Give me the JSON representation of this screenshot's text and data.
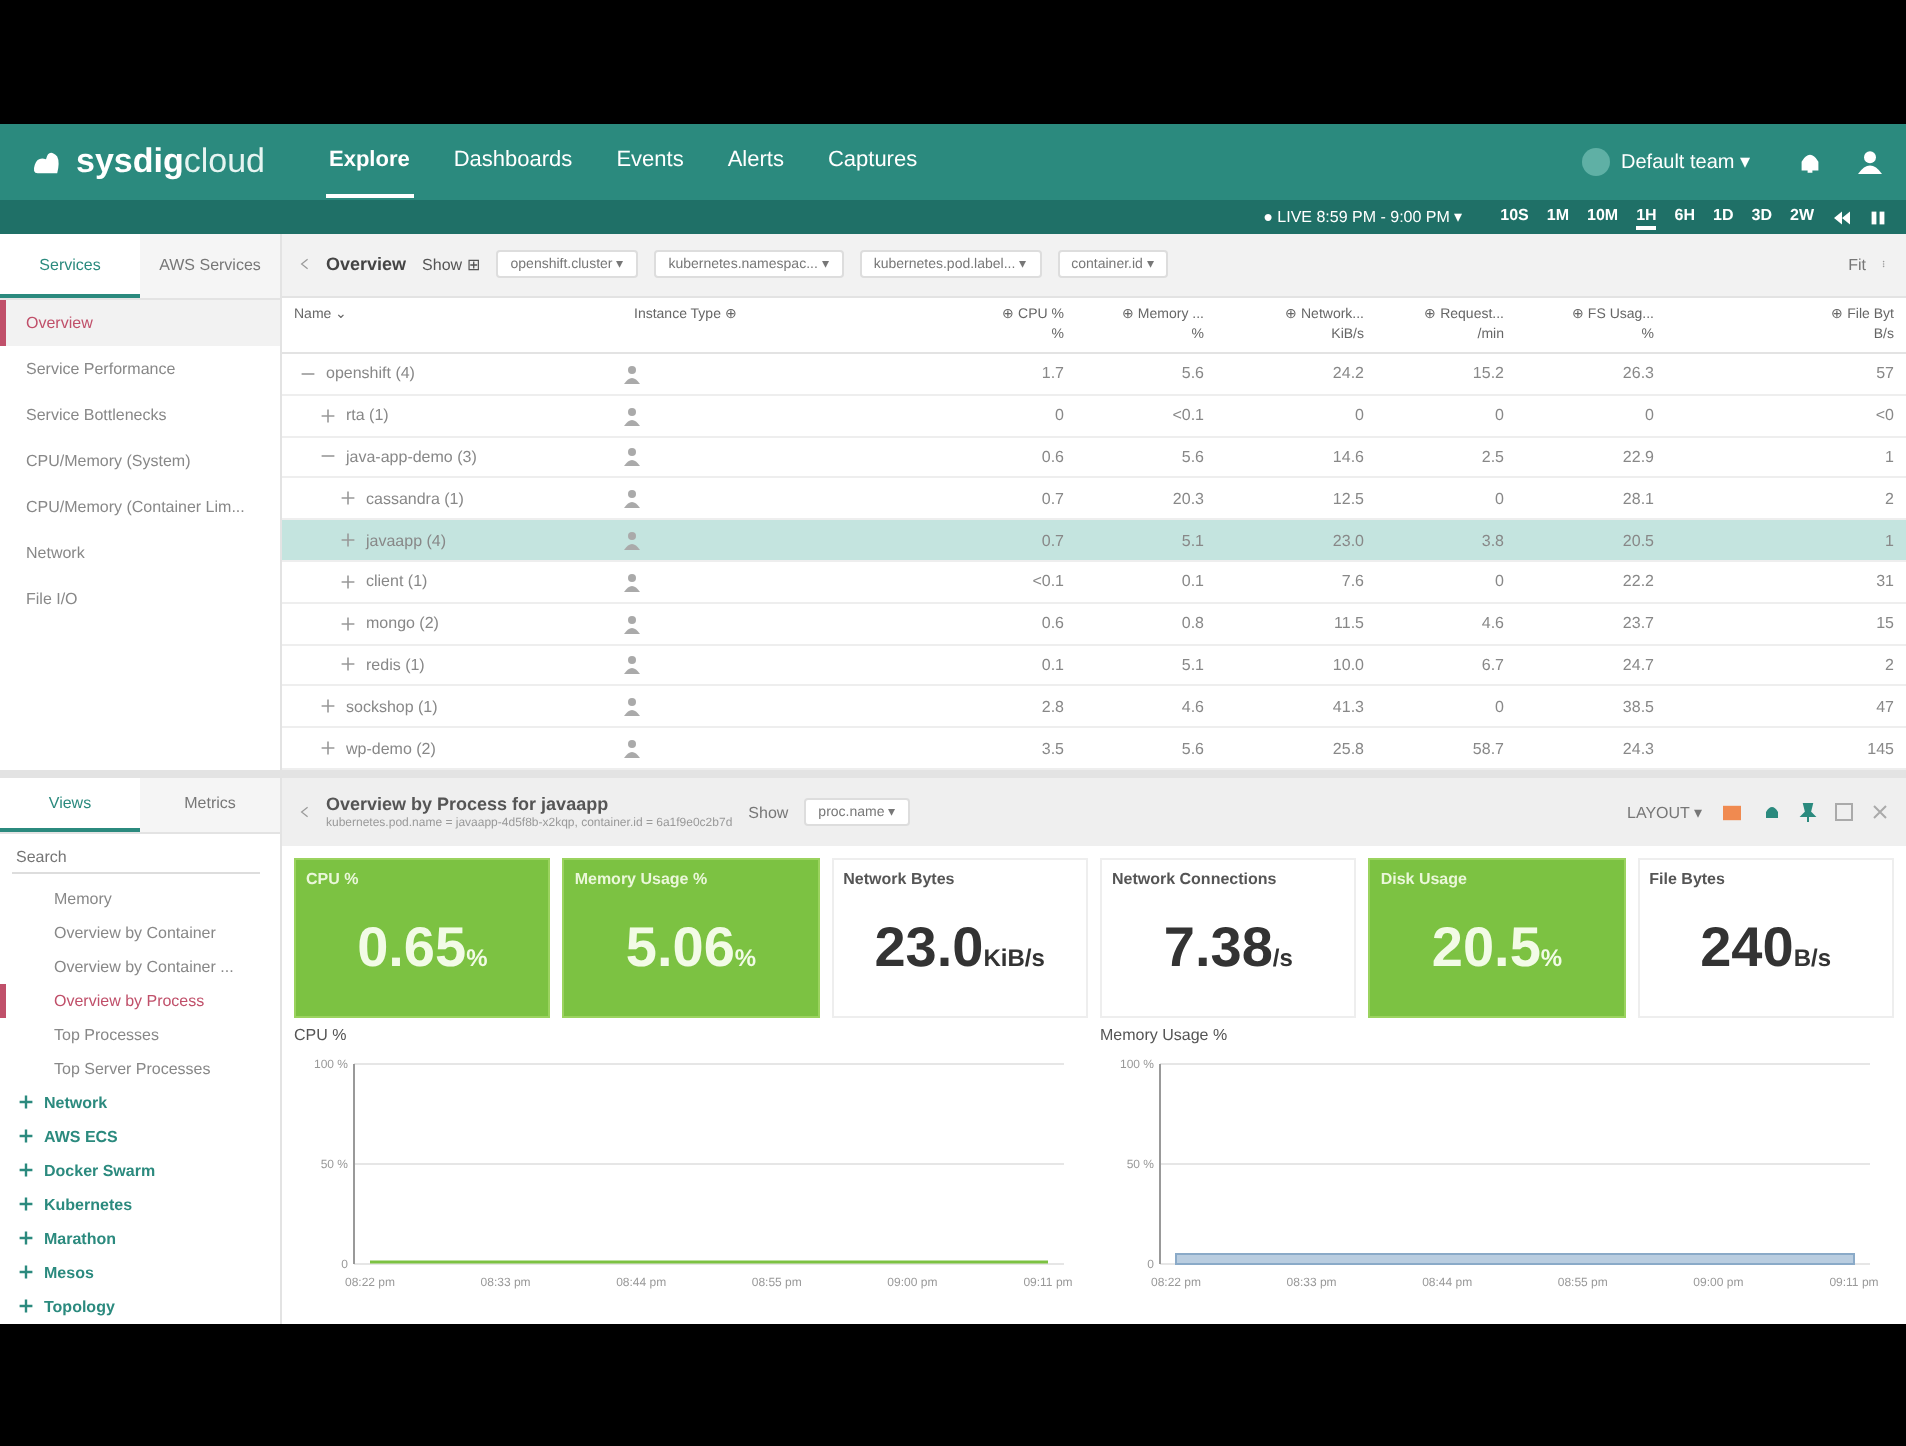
{
  "header": {
    "logo": "sysdig",
    "logo_suffix": "cloud",
    "nav": [
      {
        "label": "Explore",
        "selected": true
      },
      {
        "label": "Dashboards",
        "selected": false
      },
      {
        "label": "Events",
        "selected": false
      },
      {
        "label": "Alerts",
        "selected": false
      },
      {
        "label": "Captures",
        "selected": false
      }
    ],
    "team": "Default team ▾",
    "live": "● LIVE 8:59 PM - 9:00 PM ▾",
    "ranges": [
      {
        "label": "10S",
        "selected": false
      },
      {
        "label": "1M",
        "selected": false
      },
      {
        "label": "10M",
        "selected": false
      },
      {
        "label": "1H",
        "selected": true
      },
      {
        "label": "6H",
        "selected": false
      },
      {
        "label": "1D",
        "selected": false
      },
      {
        "label": "3D",
        "selected": false
      },
      {
        "label": "2W",
        "selected": false
      }
    ]
  },
  "sidebar": {
    "tabs": [
      {
        "label": "Services",
        "selected": true
      },
      {
        "label": "AWS Services",
        "selected": false
      }
    ],
    "items": [
      {
        "label": "Overview",
        "selected": true
      },
      {
        "label": "Service Performance",
        "selected": false
      },
      {
        "label": "Service Bottlenecks",
        "selected": false
      },
      {
        "label": "CPU/Memory (System)",
        "selected": false
      },
      {
        "label": "CPU/Memory (Container Lim...",
        "selected": false
      },
      {
        "label": "Network",
        "selected": false
      },
      {
        "label": "File I/O",
        "selected": false
      }
    ]
  },
  "breadcrumb": {
    "title": "Overview",
    "show": "Show ⊞",
    "filters": [
      "openshift.cluster ▾",
      "kubernetes.namespac... ▾",
      "kubernetes.pod.label... ▾",
      "container.id ▾"
    ],
    "fit": "Fit"
  },
  "table": {
    "columns": [
      {
        "label": "Name ⌄"
      },
      {
        "label": "Instance Type ⊕"
      },
      {
        "label": "⊕ CPU %",
        "unit": "%"
      },
      {
        "label": "⊕ Memory ...",
        "unit": "%"
      },
      {
        "label": "⊕ Network...",
        "unit": "KiB/s"
      },
      {
        "label": "⊕ Request...",
        "unit": "/min"
      },
      {
        "label": "⊕ FS Usag...",
        "unit": "%"
      },
      {
        "label": "⊕ File Byt",
        "unit": "B/s"
      }
    ],
    "rows": [
      {
        "name": "openshift (4)",
        "expanded": true,
        "selected": false,
        "values": [
          "1.7",
          "5.6",
          "24.2",
          "15.2",
          "26.3",
          "57"
        ],
        "children": [
          {
            "name": "rta (1)",
            "expanded": false,
            "selected": false,
            "values": [
              "0",
              "<0.1",
              "0",
              "0",
              "0",
              "<0"
            ]
          },
          {
            "name": "java-app-demo (3)",
            "expanded": true,
            "selected": false,
            "values": [
              "0.6",
              "5.6",
              "14.6",
              "2.5",
              "22.9",
              "1"
            ],
            "children": [
              {
                "name": "cassandra (1)",
                "expanded": false,
                "selected": false,
                "values": [
                  "0.7",
                  "20.3",
                  "12.5",
                  "0",
                  "28.1",
                  "2"
                ]
              },
              {
                "name": "javaapp (4)",
                "expanded": false,
                "selected": true,
                "values": [
                  "0.7",
                  "5.1",
                  "23.0",
                  "3.8",
                  "20.5",
                  "1"
                ]
              },
              {
                "name": "client (1)",
                "expanded": false,
                "selected": false,
                "values": [
                  "<0.1",
                  "0.1",
                  "7.6",
                  "0",
                  "22.2",
                  "31"
                ]
              },
              {
                "name": "mongo (2)",
                "expanded": false,
                "selected": false,
                "values": [
                  "0.6",
                  "0.8",
                  "11.5",
                  "4.6",
                  "23.7",
                  "15"
                ]
              },
              {
                "name": "redis (1)",
                "expanded": false,
                "selected": false,
                "values": [
                  "0.1",
                  "5.1",
                  "10.0",
                  "6.7",
                  "24.7",
                  "2"
                ]
              }
            ]
          },
          {
            "name": "sockshop (1)",
            "expanded": false,
            "selected": false,
            "values": [
              "2.8",
              "4.6",
              "41.3",
              "0",
              "38.5",
              "47"
            ]
          },
          {
            "name": "wp-demo (2)",
            "expanded": false,
            "selected": false,
            "values": [
              "3.5",
              "5.6",
              "25.8",
              "58.7",
              "24.3",
              "145"
            ]
          }
        ]
      }
    ]
  },
  "views": {
    "tabs": [
      {
        "label": "Views",
        "selected": true
      },
      {
        "label": "Metrics",
        "selected": false
      }
    ],
    "search": {
      "placeholder": "Search"
    },
    "items": [
      {
        "kind": "view",
        "label": "Memory",
        "selected": false
      },
      {
        "kind": "view",
        "label": "Overview by Container",
        "selected": false
      },
      {
        "kind": "view",
        "label": "Overview by Container ...",
        "selected": false
      },
      {
        "kind": "view",
        "label": "Overview by Process",
        "selected": true
      },
      {
        "kind": "view",
        "label": "Top Processes",
        "selected": false
      },
      {
        "kind": "view",
        "label": "Top Server Processes",
        "selected": false
      },
      {
        "kind": "group",
        "label": "Network",
        "expanded": false
      },
      {
        "kind": "group",
        "label": "AWS ECS",
        "expanded": false
      },
      {
        "kind": "group",
        "label": "Docker Swarm",
        "expanded": false
      },
      {
        "kind": "group",
        "label": "Kubernetes",
        "expanded": false
      },
      {
        "kind": "group",
        "label": "Marathon",
        "expanded": false
      },
      {
        "kind": "group",
        "label": "Mesos",
        "expanded": false
      },
      {
        "kind": "group",
        "label": "Topology",
        "expanded": false
      }
    ]
  },
  "panel": {
    "title": "Overview by Process for javaapp",
    "subtitle": "kubernetes.pod.name = javaapp-4d5f8b-x2kqp, container.id = 6a1f9e0c2b7d",
    "show_label": "Show",
    "show_value": "proc.name ▾",
    "layout": "LAYOUT ▾",
    "tiles": [
      {
        "label": "CPU %",
        "value": "0.65",
        "unit": "%",
        "highlighted": true
      },
      {
        "label": "Memory Usage %",
        "value": "5.06",
        "unit": "%",
        "highlighted": true
      },
      {
        "label": "Network Bytes",
        "value": "23.0",
        "unit": "KiB/s",
        "highlighted": false
      },
      {
        "label": "Network Connections",
        "value": "7.38",
        "unit": "/s",
        "highlighted": false
      },
      {
        "label": "Disk Usage",
        "value": "20.5",
        "unit": "%",
        "highlighted": true
      },
      {
        "label": "File Bytes",
        "value": "240",
        "unit": "B/s",
        "highlighted": false
      }
    ],
    "charts": [
      {
        "chart_data": {
          "type": "line",
          "title": "CPU %",
          "x": [
            "08:22 pm",
            "08:33 pm",
            "08:44 pm",
            "08:55 pm",
            "09:00 pm",
            "09:11 pm"
          ],
          "values": [
            1,
            1,
            1,
            1,
            1,
            1
          ],
          "ylim": [
            0,
            100
          ],
          "yticks": [
            {
              "value": 0,
              "label": "0"
            },
            {
              "value": 50,
              "label": "50 %"
            },
            {
              "value": 100,
              "label": "100 %"
            }
          ]
        }
      },
      {
        "chart_data": {
          "type": "area",
          "title": "Memory Usage %",
          "x": [
            "08:22 pm",
            "08:33 pm",
            "08:44 pm",
            "08:55 pm",
            "09:00 pm",
            "09:11 pm"
          ],
          "values": [
            5,
            5,
            5,
            5,
            5,
            5
          ],
          "ylim": [
            0,
            100
          ],
          "yticks": [
            {
              "value": 0,
              "label": "0"
            },
            {
              "value": 50,
              "label": "50 %"
            },
            {
              "value": 100,
              "label": "100 %"
            }
          ]
        }
      }
    ]
  }
}
